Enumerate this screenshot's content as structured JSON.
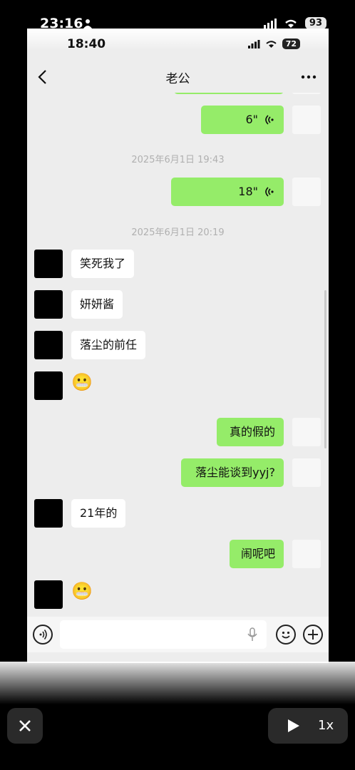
{
  "outer_status": {
    "time": "23:16",
    "battery": "93"
  },
  "inner_status": {
    "time": "18:40",
    "battery": "72"
  },
  "header": {
    "title": "老公"
  },
  "timestamps": [
    "2025年6月1日 19:43",
    "2025年6月1日 20:19"
  ],
  "messages": [
    {
      "side": "out",
      "type": "voice",
      "text": "6\""
    },
    {
      "side": "out",
      "type": "voice",
      "text": "18\""
    },
    {
      "side": "in",
      "type": "text",
      "text": "笑死我了"
    },
    {
      "side": "in",
      "type": "text",
      "text": "妍妍酱"
    },
    {
      "side": "in",
      "type": "text",
      "text": "落尘的前任"
    },
    {
      "side": "in",
      "type": "emoji",
      "text": "😬"
    },
    {
      "side": "out",
      "type": "text",
      "text": "真的假的"
    },
    {
      "side": "out",
      "type": "text",
      "text": "落尘能谈到yyj?"
    },
    {
      "side": "in",
      "type": "text",
      "text": "21年的"
    },
    {
      "side": "out",
      "type": "text",
      "text": "闹呢吧"
    },
    {
      "side": "in",
      "type": "emoji",
      "text": "😬"
    }
  ],
  "player": {
    "speed": "1x"
  },
  "colors": {
    "outgoing_bubble": "#95ec69",
    "incoming_bubble": "#ffffff",
    "chat_background": "#ededed"
  }
}
